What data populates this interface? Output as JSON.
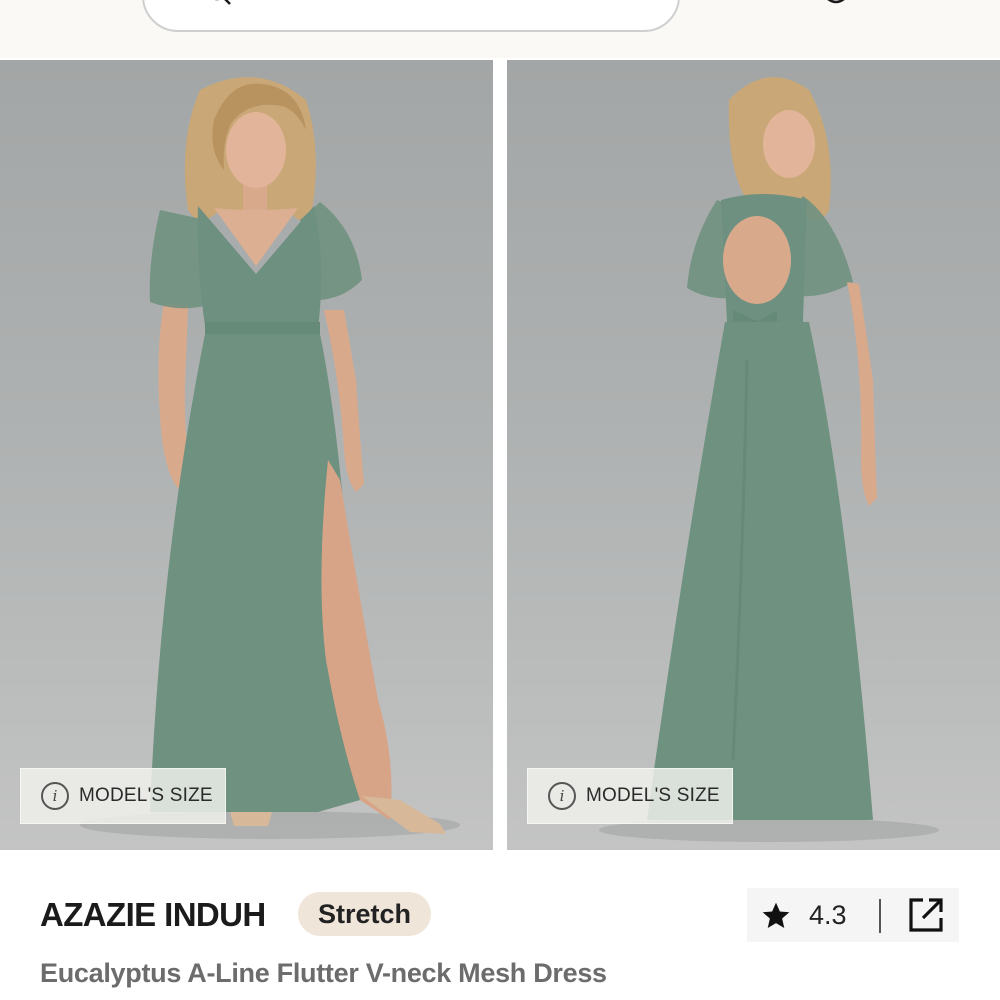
{
  "header": {
    "search": {
      "icon": "search-icon"
    },
    "bag": {
      "icon": "bag-icon"
    },
    "menu": {
      "icon": "menu-icon"
    }
  },
  "gallery": {
    "images": [
      {
        "view": "front",
        "badge_label": "MODEL'S SIZE",
        "badge_icon": "info-icon"
      },
      {
        "view": "back",
        "badge_label": "MODEL'S SIZE",
        "badge_icon": "info-icon"
      }
    ],
    "dress_color": "#6f9180"
  },
  "product": {
    "brand": "AZAZIE INDUH",
    "tag": "Stretch",
    "name": "Eucalyptus A-Line Flutter V-neck Mesh Dress",
    "rating": "4.3",
    "rating_icon": "star-icon",
    "share_icon": "share-icon"
  },
  "colors": {
    "tag_background": "#efe6d9",
    "text_primary": "#1b1b1b",
    "text_secondary": "#6c6c6c"
  }
}
